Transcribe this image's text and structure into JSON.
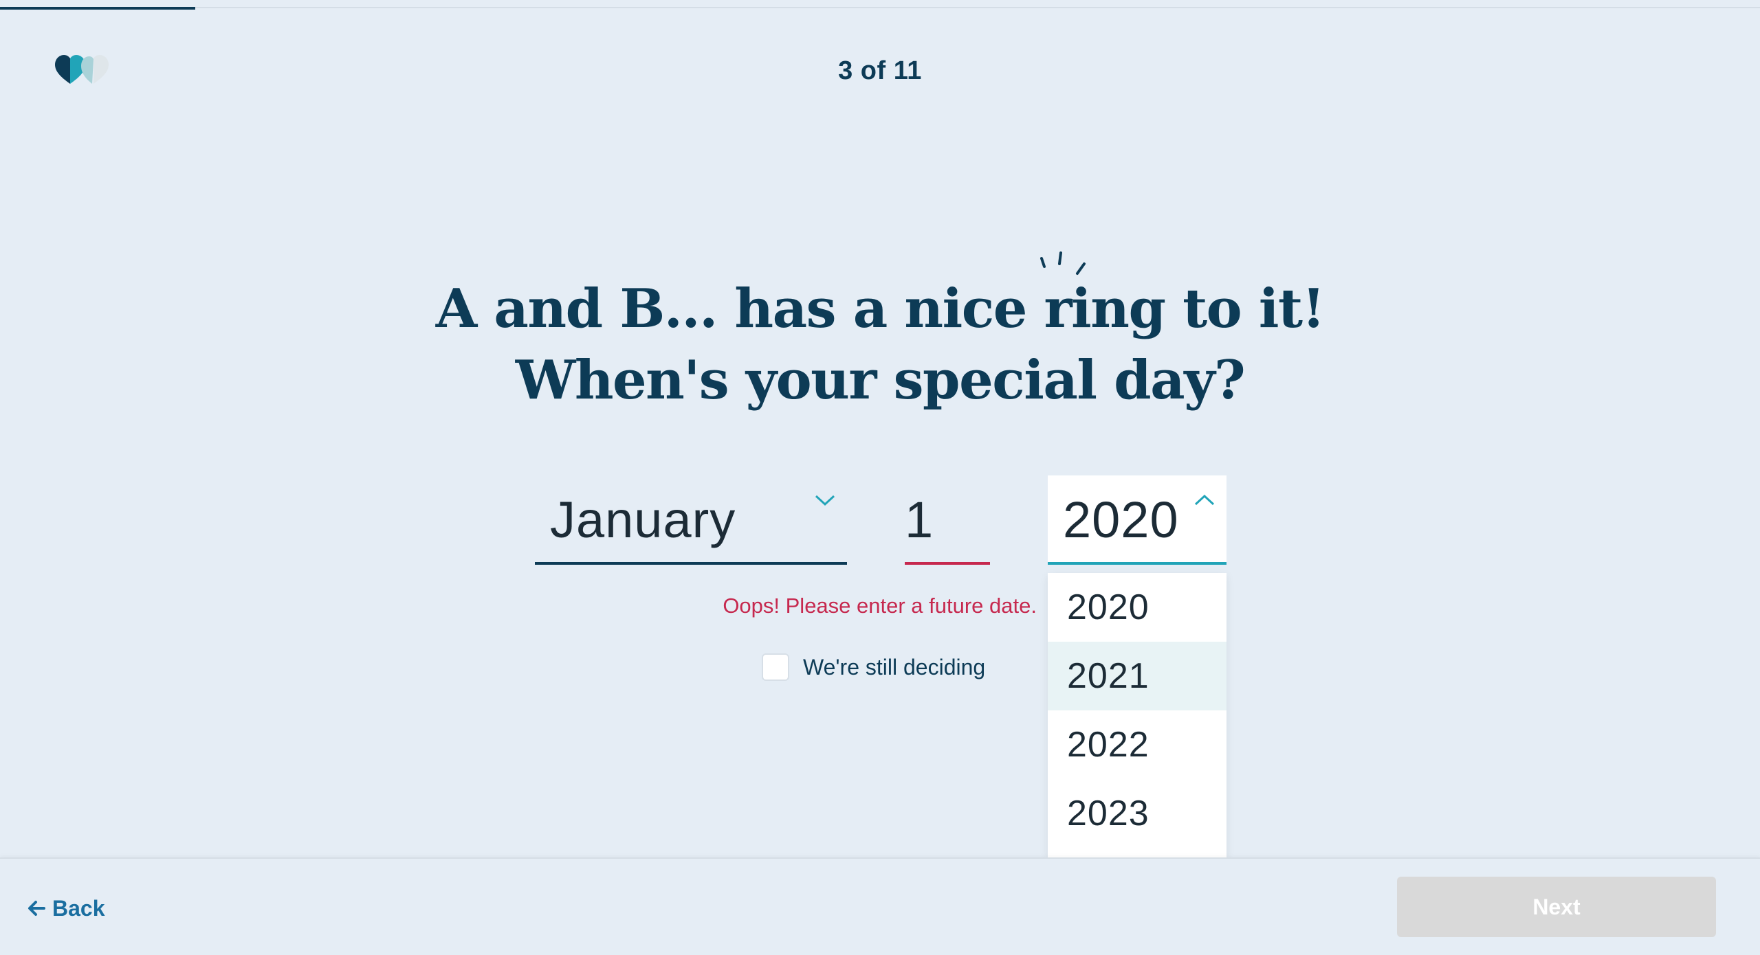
{
  "progress": {
    "fraction": 0.111
  },
  "header": {
    "step_counter": "3 of 11"
  },
  "headline": {
    "line1": "A and B... has a nice ring to it!",
    "line2": "When's your special day?"
  },
  "date_form": {
    "month": {
      "value": "January"
    },
    "day": {
      "value": "1"
    },
    "year": {
      "value": "2020",
      "options": [
        "2020",
        "2021",
        "2022",
        "2023"
      ],
      "highlighted": "2021"
    },
    "error": "Oops! Please enter a future date.",
    "still_deciding_label": "We're still deciding"
  },
  "footer": {
    "back_label": "Back",
    "next_label": "Next"
  },
  "colors": {
    "background": "#e5edf5",
    "primary": "#0d3b56",
    "accent": "#21a4b8",
    "error": "#c6284e",
    "link": "#1a6ea0",
    "disabled": "#d9d9d9"
  },
  "icons": [
    "heart-logo-icon",
    "chevron-down-icon",
    "chevron-up-icon",
    "arrow-left-icon",
    "sparkle-icon"
  ]
}
